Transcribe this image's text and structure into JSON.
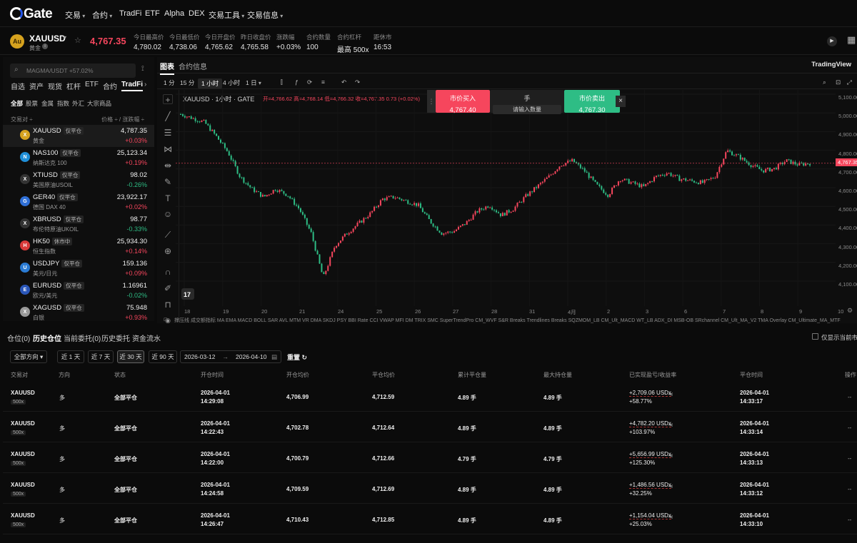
{
  "nav": {
    "logo": "Gate",
    "items": [
      "交易",
      "合约",
      "TradFi",
      "ETF",
      "Alpha",
      "DEX",
      "交易工具",
      "交易信息"
    ]
  },
  "ticker": {
    "symbol": "XAUUSD",
    "name": "黄金",
    "price": "4,767.35",
    "stats": [
      {
        "label": "今日最高价",
        "value": "4,780.02"
      },
      {
        "label": "今日最低价",
        "value": "4,738.06"
      },
      {
        "label": "今日开盘价",
        "value": "4,765.62"
      },
      {
        "label": "昨日收盘价",
        "value": "4,765.58"
      },
      {
        "label": "涨跌幅",
        "value": "+0.03%"
      },
      {
        "label": "合约数量",
        "value": "100"
      },
      {
        "label": "合约杠杆",
        "value": "最高 500x"
      },
      {
        "label": "距休市",
        "value": "16:53"
      }
    ]
  },
  "left": {
    "search_placeholder": "MAGMA/USDT +57.02%",
    "tabs": [
      "自选",
      "资产",
      "现货",
      "杠杆",
      "ETF",
      "合约",
      "TradFi"
    ],
    "subtabs": [
      "全部",
      "股票",
      "金属",
      "指数",
      "外汇",
      "大宗商品"
    ],
    "col_pair": "交易对 ÷",
    "col_price": "价格 ÷ / 涨跌幅 ÷",
    "items": [
      {
        "sym": "XAUUSD",
        "badge": "仅平仓",
        "name": "黄金",
        "price": "4,787.35",
        "chg": "+0.03%",
        "dir": "up_red",
        "icon": "#d6a21e"
      },
      {
        "sym": "NAS100",
        "badge": "仅平仓",
        "name": "纳斯达克 100",
        "price": "25,123.34",
        "chg": "+0.19%",
        "dir": "up_red",
        "icon": "#1f8fd8"
      },
      {
        "sym": "XTIUSD",
        "badge": "仅平仓",
        "name": "美国原油USOIL",
        "price": "98.02",
        "chg": "-0.26%",
        "dir": "down_green",
        "icon": "#333333"
      },
      {
        "sym": "GER40",
        "badge": "仅平仓",
        "name": "德国 DAX 40",
        "price": "23,922.17",
        "chg": "+0.02%",
        "dir": "up_red",
        "icon": "#2f6fd6"
      },
      {
        "sym": "XBRUSD",
        "badge": "仅平仓",
        "name": "布伦特原油UKOIL",
        "price": "98.77",
        "chg": "-0.33%",
        "dir": "down_green",
        "icon": "#333333"
      },
      {
        "sym": "HK50",
        "badge": "休市中",
        "name": "恒生指数",
        "price": "25,934.30",
        "chg": "+0.14%",
        "dir": "up_red",
        "icon": "#d83a3a"
      },
      {
        "sym": "USDJPY",
        "badge": "仅平仓",
        "name": "美元/日元",
        "price": "159.136",
        "chg": "+0.09%",
        "dir": "up_red",
        "icon": "#2a7bd4"
      },
      {
        "sym": "EURUSD",
        "badge": "仅平仓",
        "name": "欧元/美元",
        "price": "1.16961",
        "chg": "-0.02%",
        "dir": "down_green",
        "icon": "#2a56b8"
      },
      {
        "sym": "XAGUSD",
        "badge": "仅平仓",
        "name": "白银",
        "price": "75.948",
        "chg": "+0.93%",
        "dir": "up_red",
        "icon": "#9a9a9a"
      }
    ]
  },
  "chart": {
    "tabs": [
      "图表",
      "合约信息"
    ],
    "provider": "TradingView",
    "timeframes": [
      "1 分",
      "15 分",
      "1 小时",
      "4 小时",
      "1 日"
    ],
    "legend_title": "XAUUSD · 1小时 · GATE",
    "ohlc": "开=4,766.62 高=4,768.14 低=4,766.32 收=4,767.35 0.73 (+0.02%)",
    "buy_label": "市价买入",
    "buy_price": "4,767.40",
    "qty_label": "手",
    "qty_placeholder": "请输入数量",
    "sell_label": "市价卖出",
    "sell_price": "4,767.30",
    "last_price_tag": "4,767.35",
    "y_ticks": [
      "5,100.00",
      "5,000.00",
      "4,900.00",
      "4,800.00",
      "4,700.00",
      "4,600.00",
      "4,500.00",
      "4,400.00",
      "4,300.00",
      "4,200.00",
      "4,100.00"
    ],
    "x_ticks": [
      "18",
      "19",
      "20",
      "21",
      "24",
      "25",
      "26",
      "27",
      "28",
      "31",
      "4月",
      "2",
      "3",
      "6",
      "7",
      "8",
      "9",
      "10"
    ],
    "indicators": "撑压线  成交额指标  MA  EMA  MACD  BOLL  SAR  AVL  MTM  VR  DMA  SKDJ  PSY  BBI  Rate  CCI  VWAP  MFI  DM  TRIX  SMC  SuperTrendPro  CM_WVF  S&R Breaks  Trendlines Breaks  SQZMOM_LB  CM_Ult_MACD  WT_LB  ADX_DI  MSB-OB  SRchannel  CM_Ult_MA_V2  TMA Overlay  CM_Ultimate_MA_MTF"
  },
  "chart_data": {
    "type": "candlestick",
    "x": [
      "18",
      "19",
      "20",
      "21",
      "24",
      "25",
      "26",
      "27",
      "28",
      "31",
      "4月",
      "2",
      "3",
      "6",
      "7",
      "8",
      "9",
      "10"
    ],
    "close_path": [
      5010,
      4990,
      4970,
      4900,
      4820,
      4700,
      4640,
      4600,
      4640,
      4610,
      4540,
      4420,
      4200,
      4360,
      4420,
      4470,
      4520,
      4590,
      4600,
      4580,
      4560,
      4480,
      4420,
      4430,
      4470,
      4530,
      4560,
      4510,
      4540,
      4600,
      4650,
      4700,
      4760,
      4780,
      4730,
      4660,
      4610,
      4690,
      4670,
      4650,
      4700,
      4720,
      4690,
      4680,
      4670,
      4700,
      4830,
      4800,
      4760,
      4730,
      4740,
      4780,
      4760,
      4767
    ],
    "ylim": [
      4060,
      5130
    ]
  },
  "bottom": {
    "tabs": [
      "仓位(0)",
      "历史仓位",
      "当前委托(0)",
      "历史委托",
      "资金流水"
    ],
    "show_current": "仅显示当前市场",
    "filter_dir": "全部方向",
    "ranges": [
      "近 1 天",
      "近 7 天",
      "近 30 天",
      "近 90 天"
    ],
    "date_from": "2026-03-12",
    "date_to": "2026-04-10",
    "reset": "重置",
    "headers": [
      "交易对",
      "方向",
      "状态",
      "开仓时间",
      "开仓均价",
      "平仓均价",
      "累计平仓量",
      "最大持仓量",
      "已实现盈亏/收益率",
      "平仓时间",
      "操作"
    ],
    "rows": [
      {
        "pair": "XAUUSD",
        "lev": "500x",
        "dir": "多",
        "status": "全部平仓",
        "open_date": "2026-04-01",
        "open_time": "14:29:08",
        "open_px": "4,706.99",
        "close_px": "4,712.59",
        "closed": "4.89 手",
        "max": "4.89 手",
        "pnl": "+2,709.06 USDx",
        "pct": "+58.77%",
        "close_date": "2026-04-01",
        "close_time": "14:33:17",
        "op": "--"
      },
      {
        "pair": "XAUUSD",
        "lev": "500x",
        "dir": "多",
        "status": "全部平仓",
        "open_date": "2026-04-01",
        "open_time": "14:22:43",
        "open_px": "4,702.78",
        "close_px": "4,712.64",
        "closed": "4.89 手",
        "max": "4.89 手",
        "pnl": "+4,782.20 USDx",
        "pct": "+103.97%",
        "close_date": "2026-04-01",
        "close_time": "14:33:14",
        "op": "--"
      },
      {
        "pair": "XAUUSD",
        "lev": "500x",
        "dir": "多",
        "status": "全部平仓",
        "open_date": "2026-04-01",
        "open_time": "14:22:00",
        "open_px": "4,700.79",
        "close_px": "4,712.66",
        "closed": "4.79 手",
        "max": "4.79 手",
        "pnl": "+5,656.99 USDx",
        "pct": "+125.30%",
        "close_date": "2026-04-01",
        "close_time": "14:33:13",
        "op": "--"
      },
      {
        "pair": "XAUUSD",
        "lev": "500x",
        "dir": "多",
        "status": "全部平仓",
        "open_date": "2026-04-01",
        "open_time": "14:24:58",
        "open_px": "4,709.59",
        "close_px": "4,712.69",
        "closed": "4.89 手",
        "max": "4.89 手",
        "pnl": "+1,486.56 USDx",
        "pct": "+32.25%",
        "close_date": "2026-04-01",
        "close_time": "14:33:12",
        "op": "--"
      },
      {
        "pair": "XAUUSD",
        "lev": "500x",
        "dir": "多",
        "status": "全部平仓",
        "open_date": "2026-04-01",
        "open_time": "14:26:47",
        "open_px": "4,710.43",
        "close_px": "4,712.85",
        "closed": "4.89 手",
        "max": "4.89 手",
        "pnl": "+1,154.04 USDx",
        "pct": "+25.03%",
        "close_date": "2026-04-01",
        "close_time": "14:33:10",
        "op": "--"
      }
    ]
  },
  "colors": {
    "up": "#f6465d",
    "down": "#2ebd85",
    "buy": "#f6465d",
    "sell": "#2ebd85"
  }
}
